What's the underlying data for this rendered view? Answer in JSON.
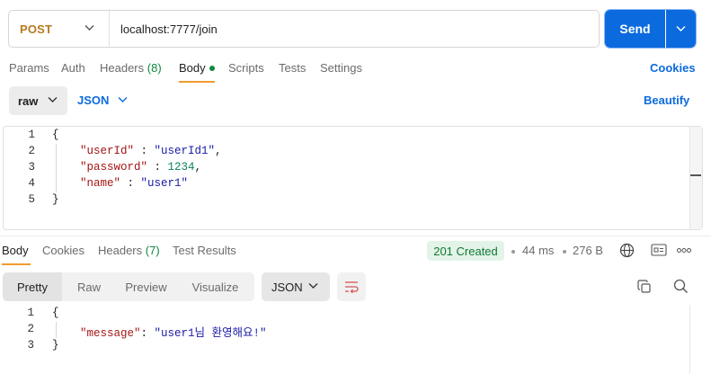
{
  "request": {
    "method": "POST",
    "url": "localhost:7777/join",
    "send_label": "Send"
  },
  "request_tabs": {
    "params": "Params",
    "auth": "Auth",
    "headers": "Headers",
    "headers_count": "(8)",
    "body": "Body",
    "scripts": "Scripts",
    "tests": "Tests",
    "settings": "Settings",
    "cookies": "Cookies"
  },
  "body_options": {
    "mode": "raw",
    "format": "JSON",
    "beautify": "Beautify"
  },
  "request_body": {
    "line_numbers": [
      "1",
      "2",
      "3",
      "4",
      "5"
    ],
    "lines": {
      "l1": "{",
      "l2_key": "\"userId\"",
      "l2_sep": " : ",
      "l2_val": "\"userId1\"",
      "l2_end": ",",
      "l3_key": "\"password\"",
      "l3_sep": " : ",
      "l3_val": "1234",
      "l3_end": ",",
      "l4_key": "\"name\"",
      "l4_sep": " : ",
      "l4_val": "\"user1\"",
      "l5": "}"
    }
  },
  "response_tabs": {
    "body": "Body",
    "cookies": "Cookies",
    "headers": "Headers",
    "headers_count": "(7)",
    "test_results": "Test Results"
  },
  "response_meta": {
    "status": "201 Created",
    "time": "44 ms",
    "size": "276 B"
  },
  "response_view": {
    "pretty": "Pretty",
    "raw": "Raw",
    "preview": "Preview",
    "visualize": "Visualize",
    "format": "JSON"
  },
  "response_body": {
    "line_numbers": [
      "1",
      "2",
      "3"
    ],
    "lines": {
      "l1": "{",
      "l2_key": "\"message\"",
      "l2_sep": ": ",
      "l2_val": "\"user1님 환영해요!\"",
      "l3": "}"
    }
  },
  "colors": {
    "method": "#b7791f",
    "accent": "#0b6bde",
    "tab_underline": "#f29b2d",
    "success": "#0f8a3c",
    "json_key": "#a31515",
    "json_string": "#1a1aa6",
    "json_number": "#098658"
  },
  "icons": [
    "chevron-down-icon",
    "globe-icon",
    "save-response-icon",
    "more-icon",
    "copy-icon",
    "search-icon",
    "wrap-lines-icon"
  ]
}
